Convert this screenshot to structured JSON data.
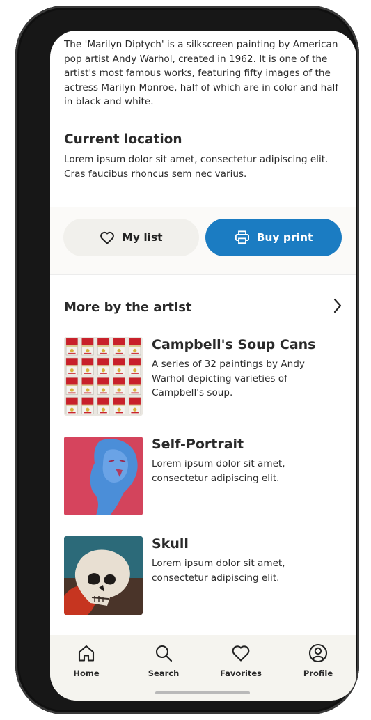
{
  "artwork": {
    "description": "The 'Marilyn Diptych' is a silkscreen painting by American pop artist Andy Warhol, created in 1962. It is one of the artist's most famous works, featuring fifty images of the actress Marilyn Monroe, half of which are in color and half in black and white."
  },
  "location": {
    "title": "Current location",
    "text": "Lorem ipsum dolor sit amet, consectetur adipiscing elit. Cras faucibus rhoncus sem nec varius."
  },
  "actions": {
    "my_list_label": "My list",
    "buy_print_label": "Buy print",
    "accent": "#1b7cc2"
  },
  "more_by_artist": {
    "title": "More by the artist",
    "items": [
      {
        "title": "Campbell's Soup Cans",
        "text": "A series of 32 paintings by Andy Warhol depicting varieties of Campbell's soup."
      },
      {
        "title": "Self-Portrait",
        "text": "Lorem ipsum dolor sit amet, consectetur adipiscing elit."
      },
      {
        "title": "Skull",
        "text": "Lorem ipsum dolor sit amet, consectetur adipiscing elit."
      }
    ]
  },
  "tabbar": {
    "items": [
      {
        "label": "Home",
        "icon": "home-icon"
      },
      {
        "label": "Search",
        "icon": "search-icon"
      },
      {
        "label": "Favorites",
        "icon": "heart-icon"
      },
      {
        "label": "Profile",
        "icon": "profile-icon"
      }
    ]
  }
}
